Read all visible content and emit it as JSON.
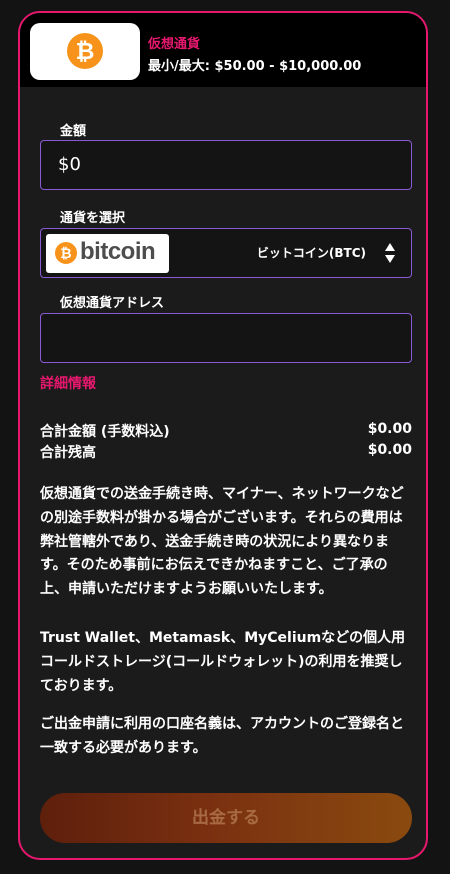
{
  "header": {
    "coin_icon": "bitcoin-icon",
    "coin_symbol": "₿",
    "title": "仮想通貨",
    "range": "最小/最大: $50.00 - $10,000.00"
  },
  "form": {
    "amount_label": "金額",
    "amount_value": "$0",
    "currency_label": "通貨を選択",
    "currency_logo_text": "bitcoin",
    "currency_selected": "ビットコイン(BTC)",
    "address_label": "仮想通貨アドレス",
    "address_value": ""
  },
  "details": {
    "link_label": "詳細情報",
    "total_amount_label": "合計金額 (手数料込)",
    "total_amount_value": "$0.00",
    "total_balance_label": "合計残高",
    "total_balance_value": "$0.00"
  },
  "notice": {
    "paragraph1": "仮想通貨での送金手続き時、マイナー、ネットワークなどの別途手数料が掛かる場合がございます。それらの費用は弊社管轄外であり、送金手続き時の状況により異なります。そのため事前にお伝えできかねますこと、ご了承の上、申請いただけますようお願いいたします。",
    "paragraph2": "Trust Wallet、Metamask、MyCeliumなどの個人用コールドストレージ(コールドウォレット)の利用を推奨しております。",
    "paragraph3": "ご出金申請に利用の口座名義は、アカウントのご登録名と一致する必要があります。"
  },
  "actions": {
    "submit_label": "出金する"
  },
  "colors": {
    "accent": "#e6186e",
    "field_border": "#8a5ad4",
    "bitcoin": "#f7931a"
  }
}
